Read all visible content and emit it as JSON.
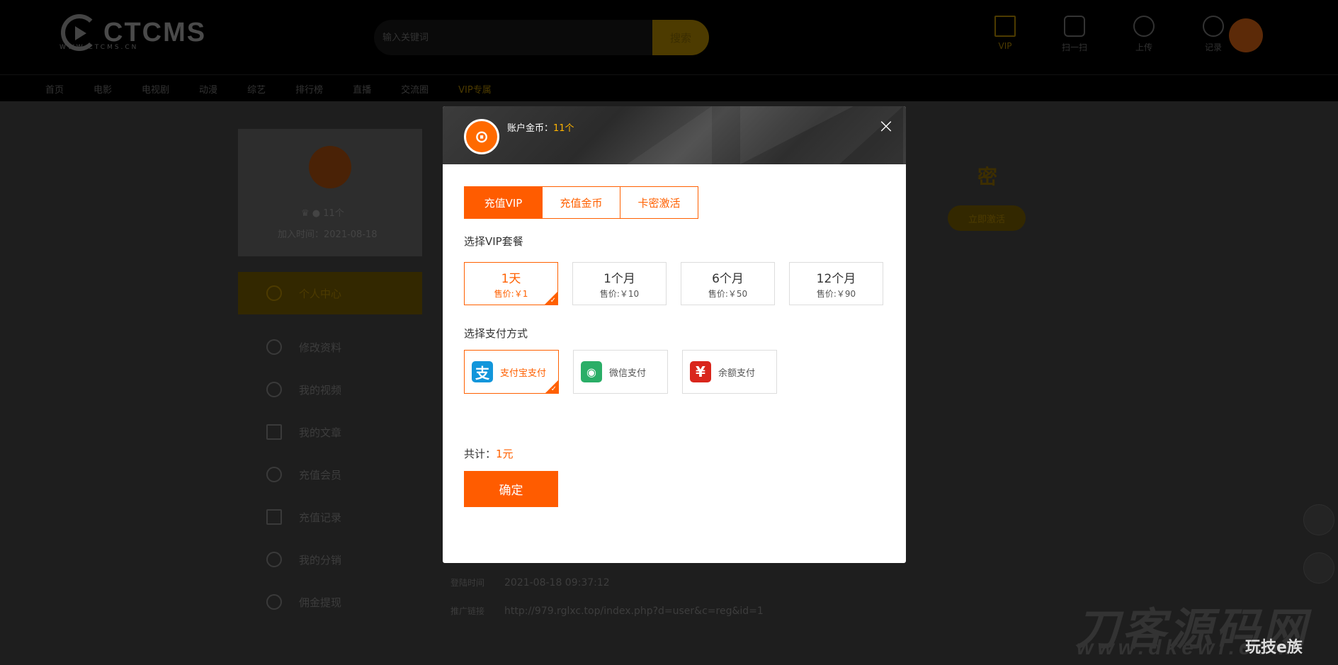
{
  "header": {
    "logo_text": "CTCMS",
    "logo_sub": "WWW.CTCMS.CN",
    "search_placeholder": "输入关键词",
    "search_button": "搜索",
    "tools": [
      {
        "icon": "crown-icon",
        "label": "VIP"
      },
      {
        "icon": "scan-icon",
        "label": "扫一扫"
      },
      {
        "icon": "upload-cloud-icon",
        "label": "上传"
      },
      {
        "icon": "clock-icon",
        "label": "记录"
      }
    ]
  },
  "nav": [
    "首页",
    "电影",
    "电视剧",
    "动漫",
    "综艺",
    "排行榜",
    "直播",
    "交流圈",
    "VIP专属"
  ],
  "profile": {
    "coins": "11个",
    "join_time": "加入时间：2021-08-18"
  },
  "sidebar": [
    "个人中心",
    "修改资料",
    "我的视频",
    "我的文章",
    "充值会员",
    "充值记录",
    "我的分销",
    "佣金提现"
  ],
  "background_page": {
    "key_title": "密",
    "activate_button": "立即激活",
    "login_time_label": "登陆时间",
    "login_time": "2021-08-18 09:37:12",
    "promo_label": "推广链接",
    "promo_url": "http://979.rglxc.top/index.php?d=user&c=reg&id=1"
  },
  "modal": {
    "avatar_glyph": "⊙",
    "coins_label": "账户金币：",
    "coins_value": "11个",
    "close_glyph": "×",
    "tabs": [
      "充值VIP",
      "充值金币",
      "卡密激活"
    ],
    "active_tab": 0,
    "plan_label": "选择VIP套餐",
    "plans": [
      {
        "name": "1天",
        "price": "售价:￥1"
      },
      {
        "name": "1个月",
        "price": "售价:￥10"
      },
      {
        "name": "6个月",
        "price": "售价:￥50"
      },
      {
        "name": "12个月",
        "price": "售价:￥90"
      }
    ],
    "selected_plan": 0,
    "pay_label": "选择支付方式",
    "pays": [
      {
        "name": "支付宝支付",
        "icon": "alipay-icon",
        "glyph": "支",
        "color": "#1296db"
      },
      {
        "name": "微信支付",
        "icon": "wechat-icon",
        "glyph": "◉",
        "color": "#2aae67"
      },
      {
        "name": "余额支付",
        "icon": "balance-yen-icon",
        "glyph": "¥",
        "color": "#d9261c"
      }
    ],
    "selected_pay": 0,
    "total_label": "共计：",
    "total_value": "1元",
    "confirm": "确定",
    "check_glyph": "✓"
  },
  "watermark": {
    "main": "刀客源码网",
    "sub": "www.dkewl.com",
    "tag": "玩技e族"
  }
}
